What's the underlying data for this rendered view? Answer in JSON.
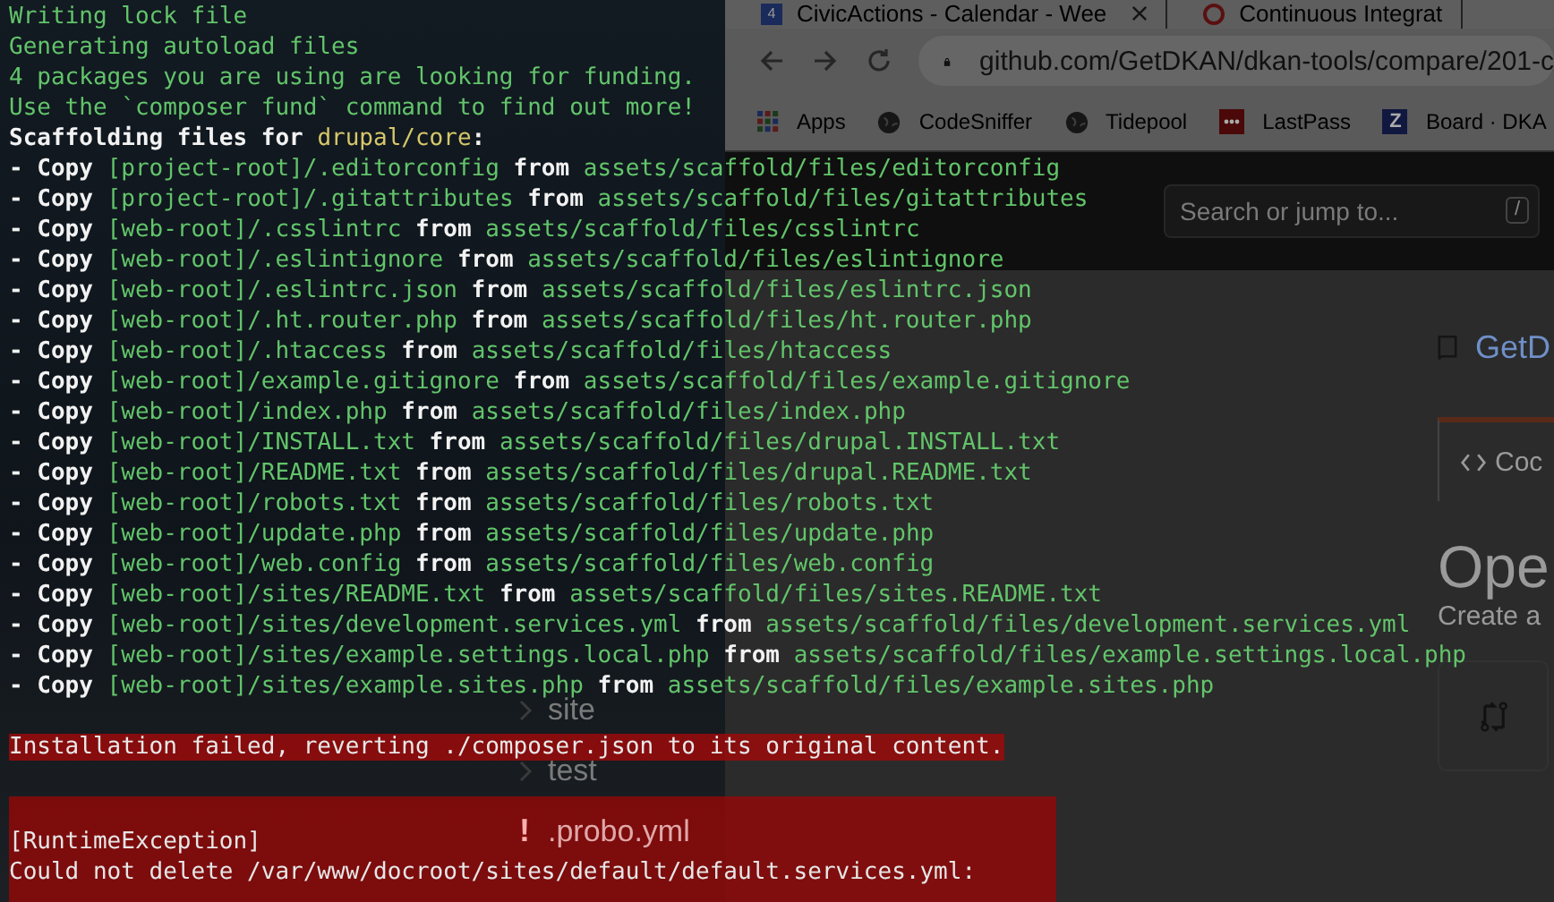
{
  "browser": {
    "tabs": [
      {
        "badge": "4",
        "title": "CivicActions - Calendar - Wee",
        "closable": true
      },
      {
        "title": "Continuous Integrat",
        "closable": false
      }
    ],
    "address": "github.com/GetDKAN/dkan-tools/compare/201-c",
    "bookmarks": [
      {
        "kind": "apps",
        "label": "Apps"
      },
      {
        "kind": "globe",
        "label": "CodeSniffer"
      },
      {
        "kind": "globe",
        "label": "Tidepool"
      },
      {
        "kind": "dots",
        "label": "LastPass"
      },
      {
        "kind": "letter",
        "badge": "Z",
        "label": "Board · DKA"
      }
    ],
    "search": {
      "placeholder": "Search or jump to...",
      "shortcut": "/"
    },
    "repo_name": "GetD",
    "code_tab": "Coc",
    "heading": "Ope",
    "subheading": "Create a"
  },
  "file_list": [
    {
      "kind": "folder",
      "name": "site"
    },
    {
      "kind": "folder",
      "name": "test"
    },
    {
      "kind": "warning",
      "mark": "!",
      "name": ".probo.yml"
    }
  ],
  "terminal": {
    "lines": [
      {
        "kind": "info",
        "text": "Writing lock file"
      },
      {
        "kind": "info",
        "text": "Generating autoload files"
      },
      {
        "kind": "info",
        "text": "4 packages you are using are looking for funding."
      },
      {
        "kind": "info",
        "text": "Use the `composer fund` command to find out more!"
      },
      {
        "kind": "heading",
        "text": "Scaffolding files for ",
        "package": "drupal/core",
        "suffix": ":"
      },
      {
        "kind": "copy",
        "action": "- Copy",
        "target": "[project-root]/.editorconfig",
        "word": "from",
        "source": "assets/scaffold/files/editorconfig"
      },
      {
        "kind": "copy",
        "action": "- Copy",
        "target": "[project-root]/.gitattributes",
        "word": "from",
        "source": "assets/scaffold/files/gitattributes"
      },
      {
        "kind": "copy",
        "action": "- Copy",
        "target": "[web-root]/.csslintrc",
        "word": "from",
        "source": "assets/scaffold/files/csslintrc"
      },
      {
        "kind": "copy",
        "action": "- Copy",
        "target": "[web-root]/.eslintignore",
        "word": "from",
        "source": "assets/scaffold/files/eslintignore"
      },
      {
        "kind": "copy",
        "action": "- Copy",
        "target": "[web-root]/.eslintrc.json",
        "word": "from",
        "source": "assets/scaffold/files/eslintrc.json"
      },
      {
        "kind": "copy",
        "action": "- Copy",
        "target": "[web-root]/.ht.router.php",
        "word": "from",
        "source": "assets/scaffold/files/ht.router.php"
      },
      {
        "kind": "copy",
        "action": "- Copy",
        "target": "[web-root]/.htaccess",
        "word": "from",
        "source": "assets/scaffold/files/htaccess"
      },
      {
        "kind": "copy",
        "action": "- Copy",
        "target": "[web-root]/example.gitignore",
        "word": "from",
        "source": "assets/scaffold/files/example.gitignore"
      },
      {
        "kind": "copy",
        "action": "- Copy",
        "target": "[web-root]/index.php",
        "word": "from",
        "source": "assets/scaffold/files/index.php"
      },
      {
        "kind": "copy",
        "action": "- Copy",
        "target": "[web-root]/INSTALL.txt",
        "word": "from",
        "source": "assets/scaffold/files/drupal.INSTALL.txt"
      },
      {
        "kind": "copy",
        "action": "- Copy",
        "target": "[web-root]/README.txt",
        "word": "from",
        "source": "assets/scaffold/files/drupal.README.txt"
      },
      {
        "kind": "copy",
        "action": "- Copy",
        "target": "[web-root]/robots.txt",
        "word": "from",
        "source": "assets/scaffold/files/robots.txt"
      },
      {
        "kind": "copy",
        "action": "- Copy",
        "target": "[web-root]/update.php",
        "word": "from",
        "source": "assets/scaffold/files/update.php"
      },
      {
        "kind": "copy",
        "action": "- Copy",
        "target": "[web-root]/web.config",
        "word": "from",
        "source": "assets/scaffold/files/web.config"
      },
      {
        "kind": "copy",
        "action": "- Copy",
        "target": "[web-root]/sites/README.txt",
        "word": "from",
        "source": "assets/scaffold/files/sites.README.txt"
      },
      {
        "kind": "copy",
        "action": "- Copy",
        "target": "[web-root]/sites/development.services.yml",
        "word": "from",
        "source": "assets/scaffold/files/development.services.yml"
      },
      {
        "kind": "copy",
        "action": "- Copy",
        "target": "[web-root]/sites/example.settings.local.php",
        "word": "from",
        "source": "assets/scaffold/files/example.settings.local.php"
      },
      {
        "kind": "copy",
        "action": "- Copy",
        "target": "[web-root]/sites/example.sites.php",
        "word": "from",
        "source": "assets/scaffold/files/example.sites.php"
      }
    ],
    "error_line": "Installation failed, reverting ./composer.json to its original content.",
    "exception": {
      "title": "[RuntimeException]",
      "message": "Could not delete /var/www/docroot/sites/default/default.services.yml:"
    }
  }
}
